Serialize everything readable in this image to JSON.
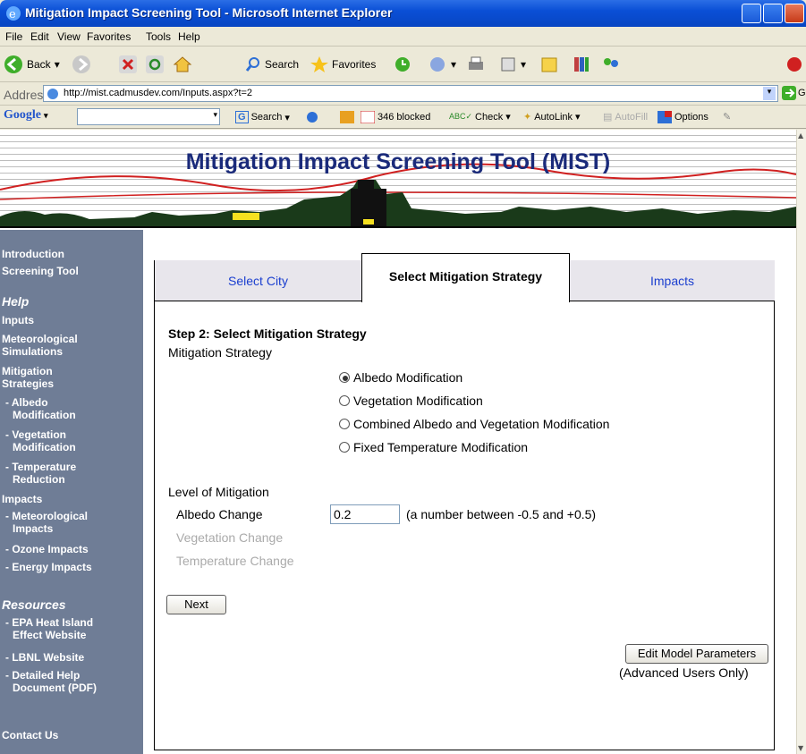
{
  "window": {
    "title": "Mitigation Impact Screening Tool - Microsoft Internet Explorer"
  },
  "menu": [
    "File",
    "Edit",
    "View",
    "Favorites",
    "Tools",
    "Help"
  ],
  "toolbar": {
    "back": "Back",
    "search": "Search",
    "favorites": "Favorites"
  },
  "address": {
    "label": "Address",
    "url": "http://mist.cadmusdev.com/Inputs.aspx?t=2",
    "go": "Go"
  },
  "google_bar": {
    "logo": "Google",
    "search": "Search",
    "blocked": "346 blocked",
    "check": "Check",
    "autolink": "AutoLink",
    "autofill": "AutoFill",
    "options": "Options"
  },
  "page": {
    "title": "Mitigation Impact Screening Tool (MIST)"
  },
  "sidebar": {
    "introduction": "Introduction",
    "screening_tool": "Screening Tool",
    "help": "Help",
    "inputs": "Inputs",
    "met_sims": [
      "Meteorological",
      "Simulations"
    ],
    "mit_strats": [
      "Mitigation",
      "Strategies"
    ],
    "albedo": [
      "- Albedo",
      "Modification"
    ],
    "vegetation": [
      "- Vegetation",
      "Modification"
    ],
    "temperature": [
      "- Temperature",
      "Reduction"
    ],
    "impacts": "Impacts",
    "met_impacts": [
      "- Meteorological",
      "Impacts"
    ],
    "ozone": "- Ozone Impacts",
    "energy": "- Energy Impacts",
    "resources": "Resources",
    "epa": [
      "- EPA Heat Island",
      "Effect Website"
    ],
    "lbnl": "- LBNL Website",
    "detailed": [
      "- Detailed Help",
      "Document (PDF)"
    ],
    "contact": "Contact Us"
  },
  "tabs": [
    "Select City",
    "Select Mitigation Strategy",
    "Impacts"
  ],
  "form": {
    "step_title": "Step 2: Select Mitigation Strategy",
    "strategy_label": "Mitigation Strategy",
    "options": [
      "Albedo Modification",
      "Vegetation Modification",
      "Combined Albedo and Vegetation Modification",
      "Fixed Temperature Modification"
    ],
    "level_label": "Level of Mitigation",
    "albedo_change": "Albedo Change",
    "albedo_value": "0.2",
    "albedo_hint": "(a number between -0.5 and +0.5)",
    "vegetation_change": "Vegetation Change",
    "temperature_change": "Temperature Change",
    "next": "Next",
    "edit_params": "Edit Model Parameters",
    "advanced": "(Advanced Users Only)"
  }
}
